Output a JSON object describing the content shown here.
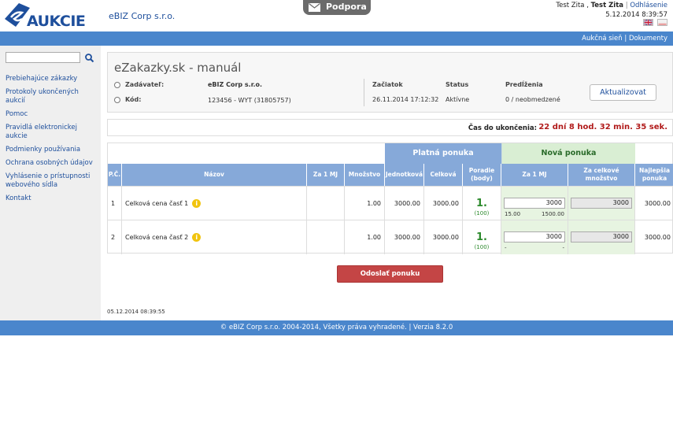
{
  "header": {
    "logo_text": "AUKCIE",
    "company": "eBIZ Corp s.r.o.",
    "support_label": "Podpora",
    "user_name": "Test Zita",
    "user_name_bold": "Test Zita",
    "logout_label": "Odhlásenie",
    "datetime": "5.12.2014 8:39:57"
  },
  "topnav": {
    "item1": "Aukčná sieň",
    "item2": "Dokumenty"
  },
  "sidebar": {
    "search_placeholder": "",
    "items": [
      {
        "label": "Prebiehajúce zákazky"
      },
      {
        "label": "Protokoly ukončených aukcií"
      },
      {
        "label": "Pomoc"
      },
      {
        "label": "Pravidlá elektronickej aukcie"
      },
      {
        "label": "Podmienky používania"
      },
      {
        "label": "Ochrana osobných údajov"
      },
      {
        "label": "Vyhlásenie o prístupnosti webového sídla"
      },
      {
        "label": "Kontakt"
      }
    ]
  },
  "auction": {
    "title": "eZakazky.sk - manuál",
    "submitter_label": "Zadávateľ:",
    "submitter_value": "eBIZ Corp s.r.o.",
    "code_label": "Kód:",
    "code_value": "123456 - WYT  (31805757)",
    "start_label": "Začiatok",
    "start_value": "26.11.2014 17:12:32",
    "status_label": "Status",
    "status_value": "Aktívne",
    "extensions_label": "Predĺženia",
    "extensions_value": "0 / neobmedzené",
    "update_button": "Aktualizovat"
  },
  "countdown": {
    "label": "Čas do ukončenia:",
    "value": "22 dní 8 hod. 32 min. 35 sek."
  },
  "table": {
    "group_platna": "Platná ponuka",
    "group_nova": "Nová ponuka",
    "headers": {
      "pc": "P.Č.",
      "nazov": "Názov",
      "za1mj": "Za 1 MJ",
      "mnozstvo": "Množstvo",
      "jednotkova": "Jednotková",
      "celkova": "Celková",
      "poradie": "Poradie (body)",
      "nova_za1mj": "Za 1 MJ",
      "za_celkove": "Za celkové množstvo",
      "najlepsia": "Najlepšia ponuka"
    },
    "rows": [
      {
        "pc": "1",
        "nazov": "Celková cena časť 1",
        "za1mj": "",
        "mnozstvo": "1.00",
        "jednotkova": "3000.00",
        "celkova": "3000.00",
        "poradie": "1.",
        "body": "(100)",
        "input_unit": "3000",
        "input_total": "3000",
        "sub_left": "15.00",
        "sub_right": "1500.00",
        "najlepsia": "3000.00"
      },
      {
        "pc": "2",
        "nazov": "Celková cena časť 2",
        "za1mj": "",
        "mnozstvo": "1.00",
        "jednotkova": "3000.00",
        "celkova": "3000.00",
        "poradie": "1.",
        "body": "(100)",
        "input_unit": "3000",
        "input_total": "3000",
        "sub_left": "-",
        "sub_right": "-",
        "najlepsia": "3000.00"
      }
    ]
  },
  "send_button": "Odoslať ponuku",
  "page_time": "05.12.2014 08:39:55",
  "footer": "© eBIZ Corp s.r.o. 2004-2014, Všetky práva vyhradené. | Verzia 8.2.0",
  "colors": {
    "brand_blue": "#1e4f9c",
    "bar_blue": "#4a86cc",
    "header_blue": "#86a9d9",
    "send_red": "#c44545",
    "countdown_red": "#b11b1b",
    "rank_green": "#2c8a2c"
  }
}
